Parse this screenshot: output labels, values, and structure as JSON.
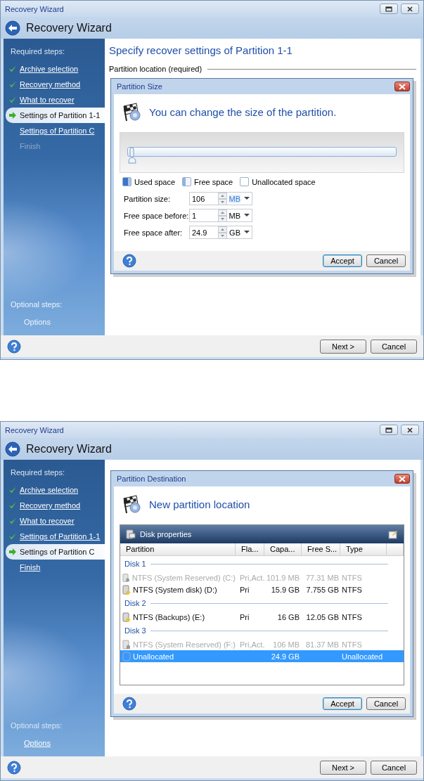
{
  "windows": [
    {
      "title": "Recovery Wizard",
      "header": "Recovery Wizard",
      "sidebar": {
        "required_label": "Required steps:",
        "steps": [
          {
            "label": "Archive selection",
            "checked": true,
            "selected": false,
            "disabled": false
          },
          {
            "label": "Recovery method",
            "checked": true,
            "selected": false,
            "disabled": false
          },
          {
            "label": "What to recover",
            "checked": true,
            "selected": false,
            "disabled": false
          },
          {
            "label": "Settings of Partition 1-1",
            "checked": false,
            "selected": true,
            "disabled": false
          },
          {
            "label": "Settings of Partition C",
            "checked": false,
            "selected": false,
            "disabled": false
          },
          {
            "label": "Finish",
            "checked": false,
            "selected": false,
            "disabled": true
          }
        ],
        "optional_label": "Optional steps:",
        "optional_steps": [
          {
            "label": "Options"
          }
        ],
        "optional_faded": true
      },
      "content": {
        "heading": "Specify recover settings of Partition 1-1",
        "section_label": "Partition location (required)"
      },
      "dialog": {
        "kind": "size",
        "title": "Partition Size",
        "heading": "You can change the size of the partition.",
        "slider": {
          "level": 0.0
        },
        "legend": [
          {
            "label": "Used space",
            "kind": "used"
          },
          {
            "label": "Free space",
            "kind": "free"
          },
          {
            "label": "Unallocated space",
            "kind": "unallocated"
          }
        ],
        "fields": [
          {
            "label": "Partition size:",
            "value": "106",
            "unit": "MB",
            "focused": true
          },
          {
            "label": "Free space before:",
            "value": "1",
            "unit": "MB",
            "focused": false
          },
          {
            "label": "Free space after:",
            "value": "24.9",
            "unit": "GB",
            "focused": false
          }
        ],
        "buttons": [
          {
            "label": "Accept",
            "default": true
          },
          {
            "label": "Cancel",
            "default": false
          }
        ]
      },
      "buttons": [
        "Next >",
        "Cancel"
      ]
    },
    {
      "title": "Recovery Wizard",
      "header": "Recovery Wizard",
      "sidebar": {
        "required_label": "Required steps:",
        "steps": [
          {
            "label": "Archive selection",
            "checked": true,
            "selected": false,
            "disabled": false
          },
          {
            "label": "Recovery method",
            "checked": true,
            "selected": false,
            "disabled": false
          },
          {
            "label": "What to recover",
            "checked": true,
            "selected": false,
            "disabled": false
          },
          {
            "label": "Settings of Partition 1-1",
            "checked": true,
            "selected": false,
            "disabled": false
          },
          {
            "label": "Settings of Partition C",
            "checked": false,
            "selected": true,
            "disabled": false
          },
          {
            "label": "Finish",
            "checked": false,
            "selected": false,
            "disabled": false
          }
        ],
        "optional_label": "Optional steps:",
        "optional_steps": [
          {
            "label": "Options"
          }
        ],
        "optional_faded": false
      },
      "dialog": {
        "kind": "destination",
        "title": "Partition Destination",
        "heading": "New partition location",
        "panel_title": "Disk properties",
        "columns": [
          "Partition",
          "Fla...",
          "Capa...",
          "Free S...",
          "Type"
        ],
        "groups": [
          {
            "name": "Disk 1",
            "rows": [
              {
                "kind": "reserved",
                "cells": [
                  "NTFS (System Reserved) (C:)",
                  "Pri,Act.",
                  "101.9 MB",
                  "77.31 MB",
                  "NTFS"
                ],
                "disabled": true,
                "selected": false
              },
              {
                "kind": "primary",
                "cells": [
                  "NTFS (System disk) (D:)",
                  "Pri",
                  "15.9 GB",
                  "7.755 GB",
                  "NTFS"
                ],
                "disabled": false,
                "selected": false
              }
            ]
          },
          {
            "name": "Disk 2",
            "rows": [
              {
                "kind": "primary",
                "cells": [
                  "NTFS (Backups) (E:)",
                  "Pri",
                  "16 GB",
                  "12.05 GB",
                  "NTFS"
                ],
                "disabled": false,
                "selected": false
              }
            ]
          },
          {
            "name": "Disk 3",
            "rows": [
              {
                "kind": "reserved",
                "cells": [
                  "NTFS (System Reserved) (F:)",
                  "Pri,Act.",
                  "106 MB",
                  "81.37 MB",
                  "NTFS"
                ],
                "disabled": true,
                "selected": false
              },
              {
                "kind": "unallocated",
                "cells": [
                  "Unallocated",
                  "",
                  "24.9 GB",
                  "",
                  "Unallocated"
                ],
                "disabled": false,
                "selected": true
              }
            ]
          }
        ],
        "buttons": [
          {
            "label": "Accept",
            "default": true
          },
          {
            "label": "Cancel",
            "default": false
          }
        ]
      },
      "buttons": [
        "Next >",
        "Cancel"
      ]
    }
  ]
}
